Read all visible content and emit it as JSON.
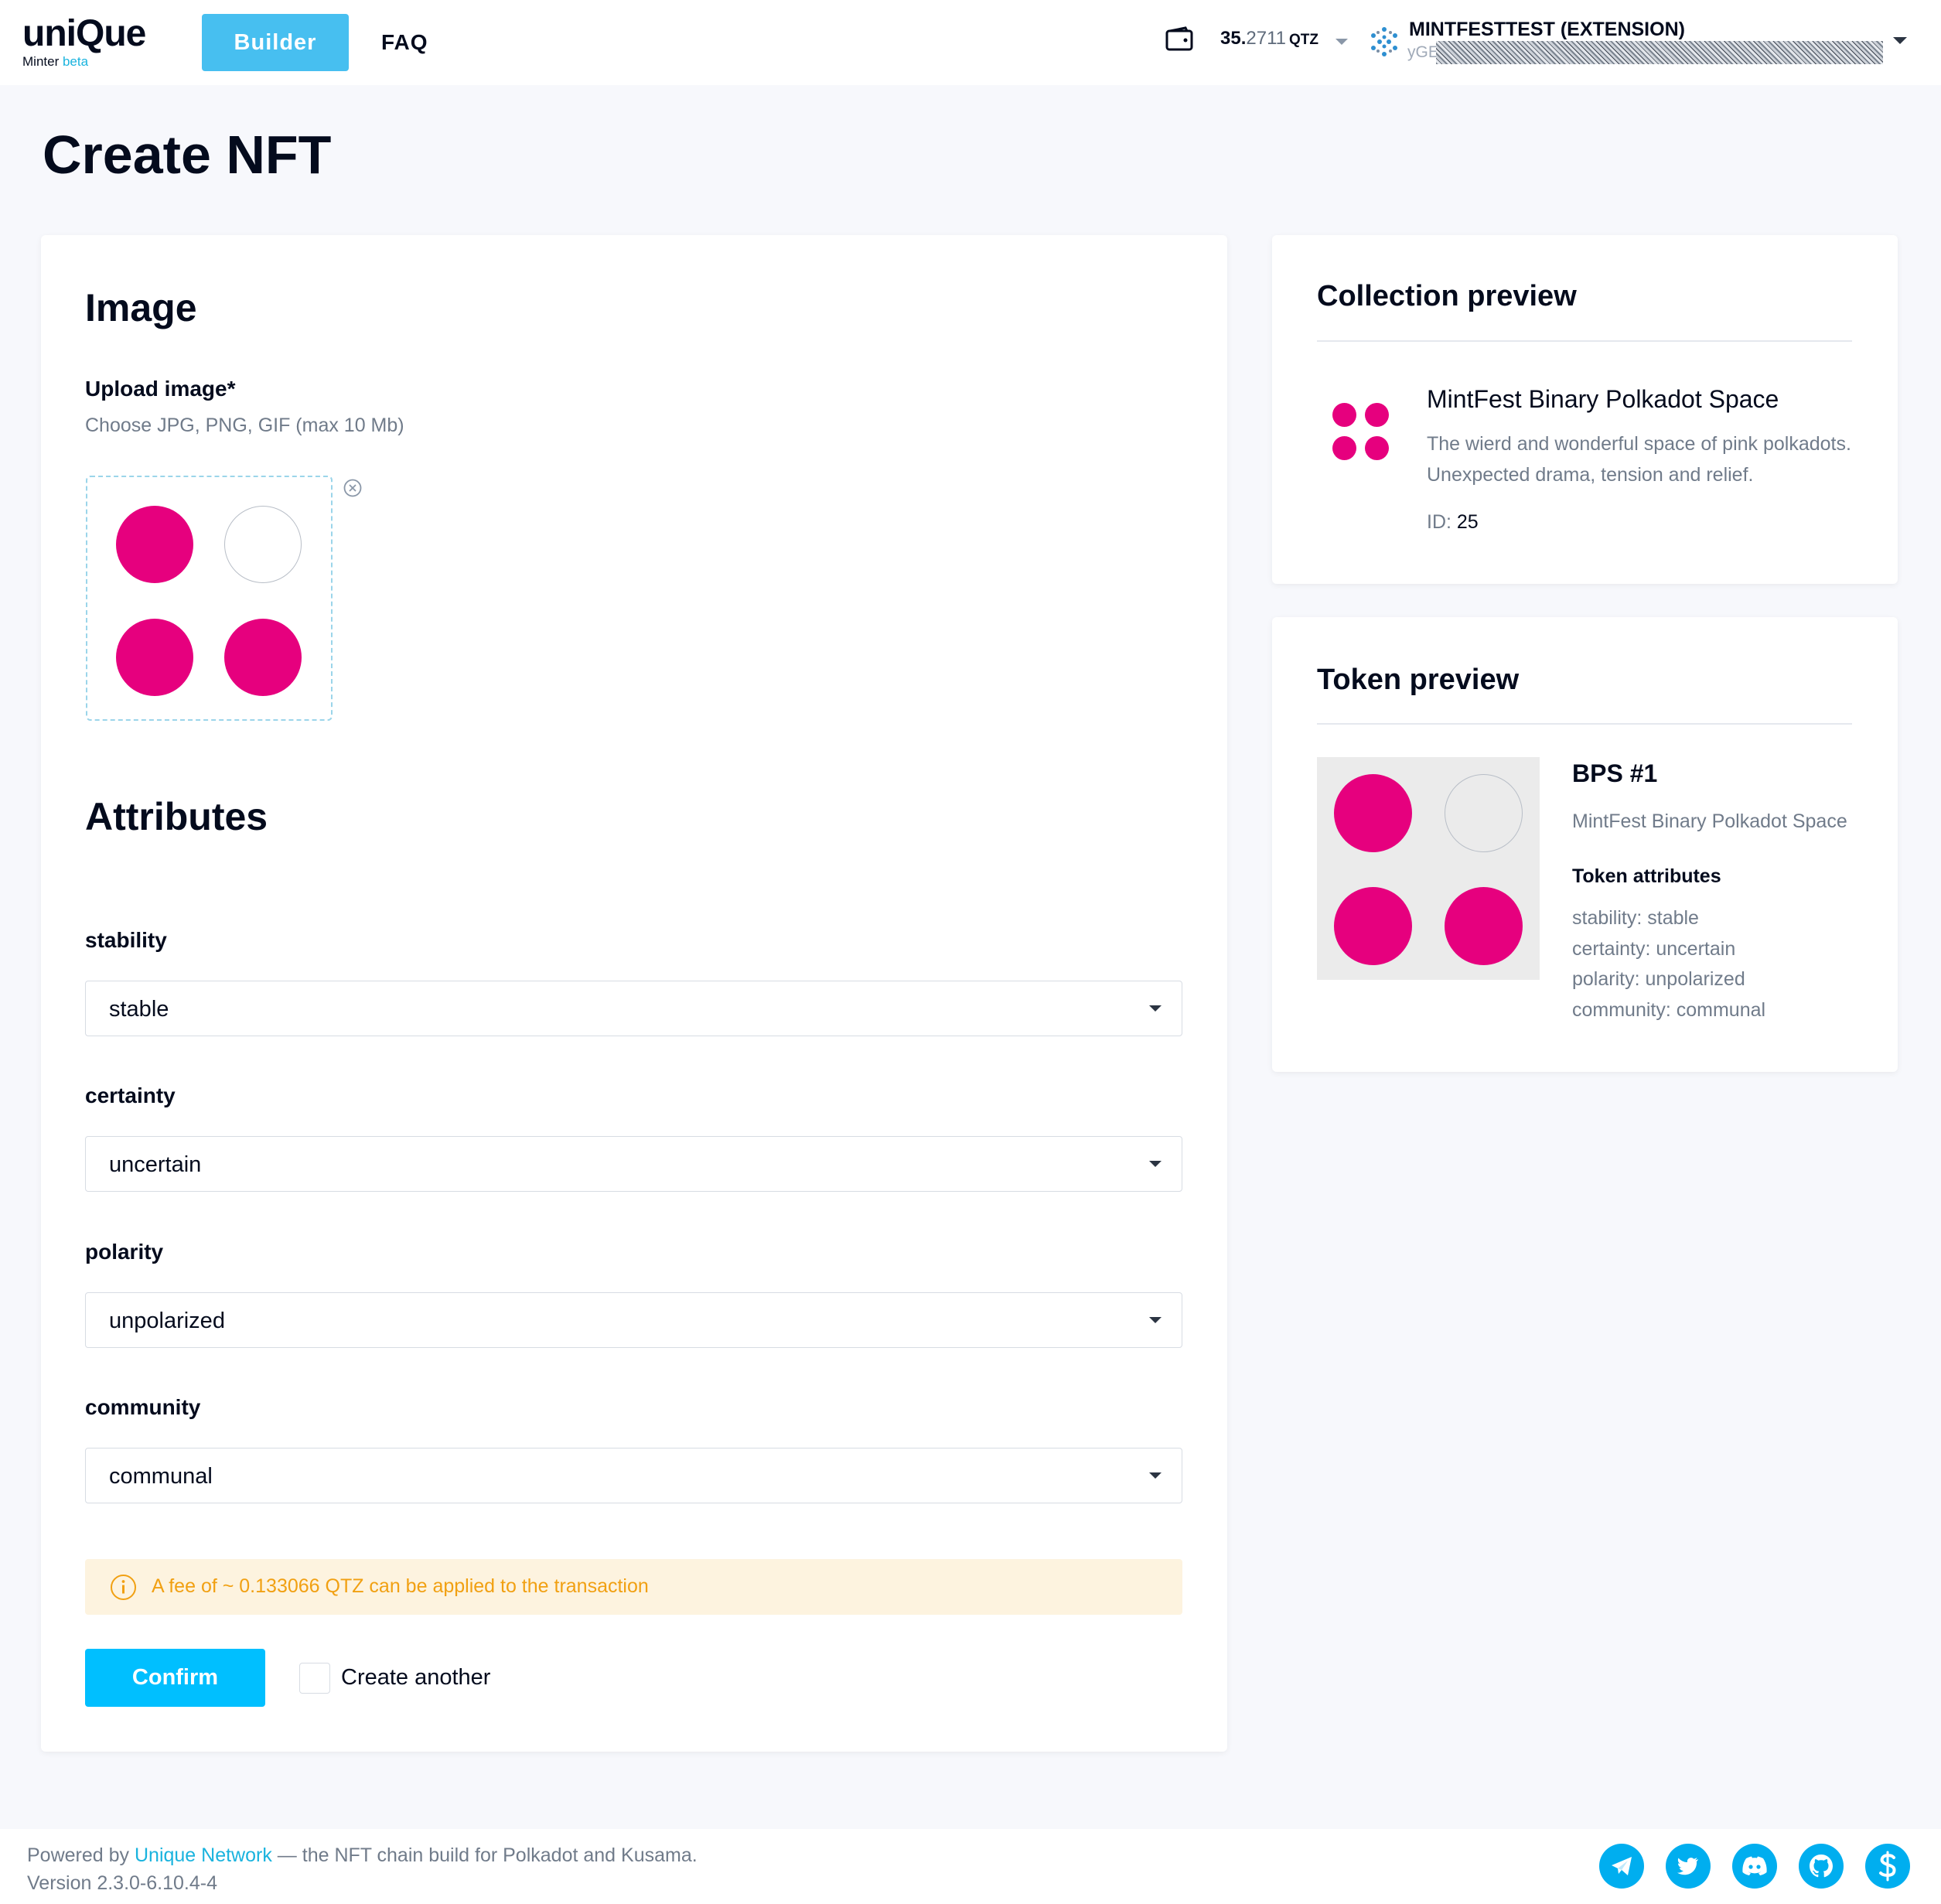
{
  "header": {
    "logo_text": "uniQue",
    "logo_sub": "Minter",
    "logo_beta": "beta",
    "nav": {
      "builder": "Builder",
      "faq": "FAQ"
    },
    "balance": {
      "int": "35.",
      "dec": "2711",
      "unit": "QTZ"
    },
    "account": {
      "name": "MINTFESTTEST (EXTENSION)",
      "address_visible": "yGE"
    }
  },
  "page": {
    "title": "Create NFT"
  },
  "image_section": {
    "title": "Image",
    "upload_label": "Upload image*",
    "upload_hint": "Choose JPG, PNG, GIF (max 10 Mb)"
  },
  "attributes_section": {
    "title": "Attributes",
    "fields": [
      {
        "label": "stability",
        "value": "stable"
      },
      {
        "label": "certainty",
        "value": "uncertain"
      },
      {
        "label": "polarity",
        "value": "unpolarized"
      },
      {
        "label": "community",
        "value": "communal"
      }
    ]
  },
  "fee": {
    "text": "A fee of ~ 0.133066 QTZ can be applied to the transaction"
  },
  "actions": {
    "confirm": "Confirm",
    "create_another": "Create another"
  },
  "collection_preview": {
    "title": "Collection preview",
    "name": "MintFest Binary Polkadot Space",
    "description": "The wierd and wonderful space of pink polkadots. Unexpected drama, tension and relief.",
    "id_label": "ID:",
    "id_value": "25"
  },
  "token_preview": {
    "title": "Token preview",
    "name": "BPS #1",
    "collection": "MintFest Binary Polkadot Space",
    "attributes_title": "Token attributes",
    "attributes": [
      "stability: stable",
      "certainty: uncertain",
      "polarity: unpolarized",
      "community: communal"
    ]
  },
  "footer": {
    "powered_prefix": "Powered by",
    "powered_link": "Unique Network",
    "powered_suffix": "— the NFT chain build for Polkadot and Kusama.",
    "version": "Version 2.3.0-6.10.4-4",
    "social_icons": [
      "telegram-icon",
      "twitter-icon",
      "discord-icon",
      "github-icon",
      "subsocial-icon"
    ]
  },
  "colors": {
    "accent": "#00bfff",
    "builder_button": "#47bff0",
    "polkadot_pink": "#e6007e",
    "fee_background": "#fdf3df",
    "fee_text": "#f1a012",
    "page_background": "#f7f8fc"
  }
}
